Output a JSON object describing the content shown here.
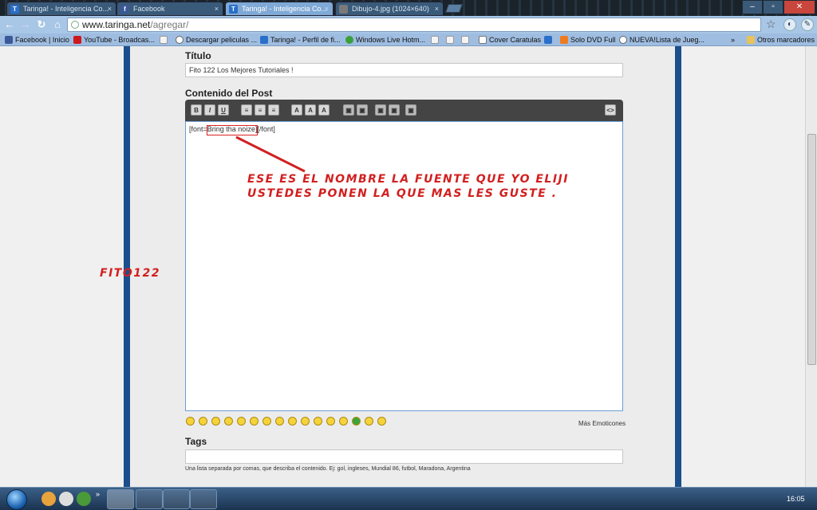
{
  "tabs": [
    {
      "label": "Taringa! - Inteligencia Co...",
      "active": false
    },
    {
      "label": "Facebook",
      "active": false
    },
    {
      "label": "Taringa! - Inteligencia Co...",
      "active": true
    },
    {
      "label": "Dibujo-4.jpg (1024×640)",
      "active": false
    }
  ],
  "address": {
    "domain": "www.taringa.net",
    "path": "/agregar/"
  },
  "bookmarks": [
    {
      "label": "Facebook | Inicio",
      "color": "#3b5998"
    },
    {
      "label": "YouTube - Broadcas...",
      "color": "#cc181e"
    },
    {
      "label": "",
      "color": "#e8e8e8"
    },
    {
      "label": "Descargar peliculas ...",
      "color": "#ffffff"
    },
    {
      "label": "Taringa! - Perfil de fi...",
      "color": "#2a6fc9"
    },
    {
      "label": "Windows Live Hotm...",
      "color": "#3aa03a"
    },
    {
      "label": "",
      "color": "#e8e8e8"
    },
    {
      "label": "",
      "color": "#e8e8e8"
    },
    {
      "label": "Cover Caratulas",
      "color": "#ffffff"
    },
    {
      "label": "",
      "color": "#2a6fc9"
    },
    {
      "label": "Solo DVD Full",
      "color": "#f07a20"
    },
    {
      "label": "NUEVA!Lista de Jueg...",
      "color": "#ffffff"
    }
  ],
  "bookmarks_more": "»",
  "other_bookmarks": "Otros marcadores",
  "form": {
    "titulo_label": "Título",
    "titulo_value": "Fito 122 Los Mejores Tutoriales !",
    "contenido_label": "Contenido del Post",
    "editor_text_pre": "[font=",
    "editor_text_font": "Bring tha noize",
    "editor_text_post": "][/font]",
    "mas_emoticones": "Más Emoticones",
    "tags_label": "Tags",
    "tags_value": "",
    "tags_help": "Una lista separada por comas, que describa el contenido. Ej: gol, ingleses, Mundial 86, futbol, Maradona, Argentina"
  },
  "editor_buttons": [
    "B",
    "I",
    "U",
    "≡",
    "≡",
    "≡",
    "A",
    "A",
    "A",
    "▣",
    "▣",
    "▣",
    "▣",
    "▣"
  ],
  "annotation": {
    "line1": "ESE ES EL NOMBRE LA FUENTE QUE YO ELIJI",
    "line2": "USTEDES PONEN LA QUE MAS LES GUSTE .",
    "signature": "FITO122",
    "color": "#d21f1f"
  },
  "clock": "16:05"
}
